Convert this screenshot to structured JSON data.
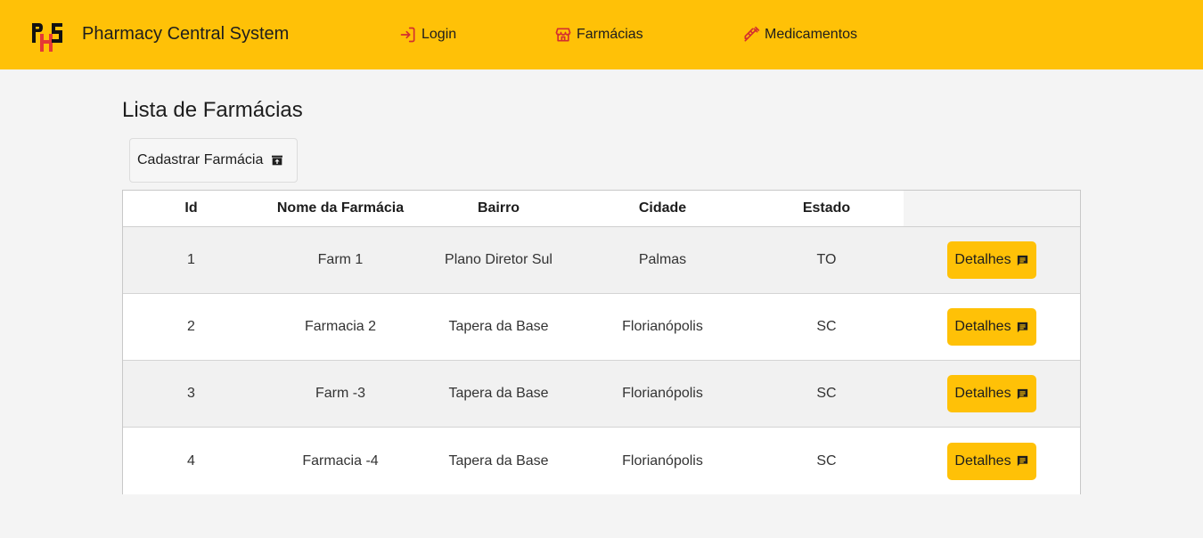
{
  "header": {
    "app_title": "Pharmacy Central System",
    "logo_text": "PHS",
    "nav": [
      {
        "label": "Login",
        "icon": "login-icon"
      },
      {
        "label": "Farmácias",
        "icon": "store-icon"
      },
      {
        "label": "Medicamentos",
        "icon": "syringe-icon"
      }
    ]
  },
  "main": {
    "title": "Lista de Farmácias",
    "add_button": {
      "label": "Cadastrar Farmácia",
      "icon": "store-add-icon"
    },
    "table": {
      "columns": [
        "Id",
        "Nome da Farmácia",
        "Bairro",
        "Cidade",
        "Estado"
      ],
      "rows": [
        {
          "id": "1",
          "nome": "Farm 1",
          "bairro": "Plano Diretor Sul",
          "cidade": "Palmas",
          "estado": "TO",
          "action": "Detalhes"
        },
        {
          "id": "2",
          "nome": "Farmacia 2",
          "bairro": "Tapera da Base",
          "cidade": "Florianópolis",
          "estado": "SC",
          "action": "Detalhes"
        },
        {
          "id": "3",
          "nome": "Farm -3",
          "bairro": "Tapera da Base",
          "cidade": "Florianópolis",
          "estado": "SC",
          "action": "Detalhes"
        },
        {
          "id": "4",
          "nome": "Farmacia -4",
          "bairro": "Tapera da Base",
          "cidade": "Florianópolis",
          "estado": "SC",
          "action": "Detalhes"
        }
      ]
    }
  },
  "colors": {
    "accent": "#ffc107",
    "icon_red": "#d32f2f",
    "background": "#f4f4f4"
  }
}
